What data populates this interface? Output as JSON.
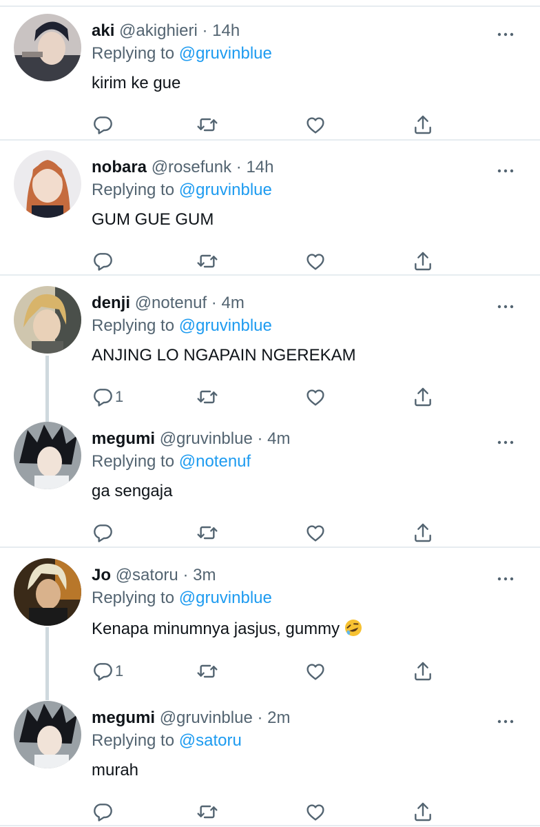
{
  "replies": [
    {
      "name": "aki",
      "handle": "@akighieri",
      "time": "14h",
      "replying_label": "Replying to",
      "replying_to": "@gruvinblue",
      "text": "kirim ke gue",
      "reply_count": "",
      "avatar": "aki-avatar"
    },
    {
      "name": "nobara",
      "handle": "@rosefunk",
      "time": "14h",
      "replying_label": "Replying to",
      "replying_to": "@gruvinblue",
      "text": "GUM GUE GUM",
      "reply_count": "",
      "avatar": "nobara-avatar"
    },
    {
      "name": "denji",
      "handle": "@notenuf",
      "time": "4m",
      "replying_label": "Replying to",
      "replying_to": "@gruvinblue",
      "text": "ANJING LO NGAPAIN NGEREKAM",
      "reply_count": "1",
      "avatar": "denji-avatar"
    },
    {
      "name": "megumi",
      "handle": "@gruvinblue",
      "time": "4m",
      "replying_label": "Replying to",
      "replying_to": "@notenuf",
      "text": "ga sengaja",
      "reply_count": "",
      "avatar": "megumi-avatar"
    },
    {
      "name": "Jo",
      "handle": "@satoru",
      "time": "3m",
      "replying_label": "Replying to",
      "replying_to": "@gruvinblue",
      "text": "Kenapa minumnya jasjus, gummy",
      "reply_count": "1",
      "avatar": "jo-avatar",
      "emoji": "rolling-on-floor-laughing"
    },
    {
      "name": "megumi",
      "handle": "@gruvinblue",
      "time": "2m",
      "replying_label": "Replying to",
      "replying_to": "@satoru",
      "text": "murah",
      "reply_count": "",
      "avatar": "megumi-avatar"
    }
  ],
  "separator": "·",
  "icons": {
    "reply": "reply-icon",
    "retweet": "retweet-icon",
    "like": "like-icon",
    "share": "share-icon",
    "more": "more-icon"
  },
  "colors": {
    "text": "#0f1419",
    "muted": "#536471",
    "link": "#1d9bf0",
    "divider": "#e6ecf0"
  }
}
